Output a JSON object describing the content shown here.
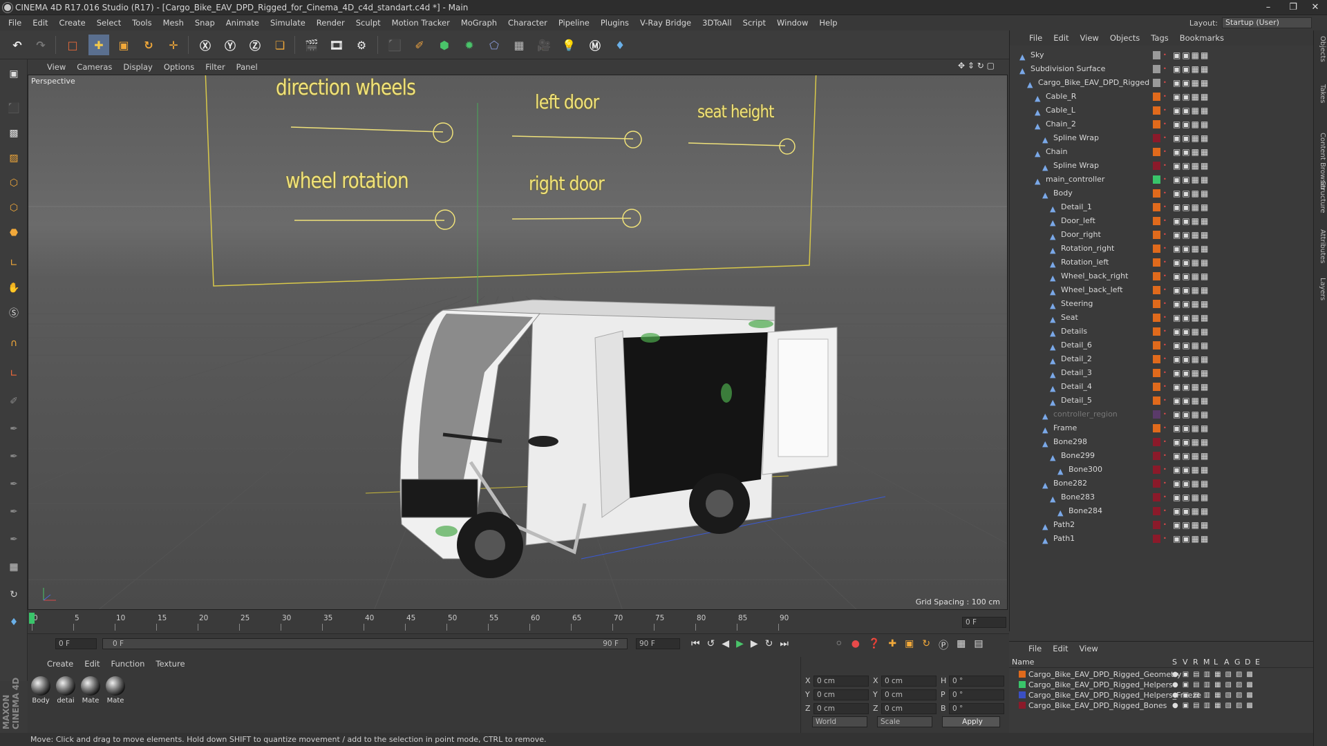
{
  "title": "CINEMA 4D R17.016 Studio (R17) - [Cargo_Bike_EAV_DPD_Rigged_for_Cinema_4D_c4d_standart.c4d *] - Main",
  "menu": [
    "File",
    "Edit",
    "Create",
    "Select",
    "Tools",
    "Mesh",
    "Snap",
    "Animate",
    "Simulate",
    "Render",
    "Sculpt",
    "Motion Tracker",
    "MoGraph",
    "Character",
    "Pipeline",
    "Plugins",
    "V-Ray Bridge",
    "3DToAll",
    "Script",
    "Window",
    "Help"
  ],
  "layout": {
    "label": "Layout:",
    "value": "Startup (User)"
  },
  "viewport": {
    "menu": [
      "View",
      "Cameras",
      "Display",
      "Options",
      "Filter",
      "Panel"
    ],
    "label": "Perspective",
    "grid_spacing": "Grid Spacing : 100 cm",
    "controls": [
      "direction wheels",
      "left door",
      "seat height",
      "wheel rotation",
      "right door"
    ]
  },
  "timeline": {
    "ticks": [
      "0",
      "5",
      "10",
      "15",
      "20",
      "25",
      "30",
      "35",
      "40",
      "45",
      "50",
      "55",
      "60",
      "65",
      "70",
      "75",
      "80",
      "85",
      "90"
    ],
    "current": "0 F"
  },
  "transport": {
    "start": "0 F",
    "range_start": "0 F",
    "range_end": "90 F",
    "end": "90 F"
  },
  "materials": {
    "menu": [
      "Create",
      "Edit",
      "Function",
      "Texture"
    ],
    "items": [
      "Body",
      "detai",
      "Mate",
      "Mate"
    ]
  },
  "coords": {
    "rows": [
      {
        "a": "X",
        "av": "0 cm",
        "b": "X",
        "bv": "0 cm",
        "c": "H",
        "cv": "0 °"
      },
      {
        "a": "Y",
        "av": "0 cm",
        "b": "Y",
        "bv": "0 cm",
        "c": "P",
        "cv": "0 °"
      },
      {
        "a": "Z",
        "av": "0 cm",
        "b": "Z",
        "bv": "0 cm",
        "c": "B",
        "cv": "0 °"
      }
    ],
    "mode": "World",
    "scale": "Scale",
    "apply": "Apply",
    "top1": "--",
    "top2": "--"
  },
  "status": "Move: Click and drag to move elements. Hold down SHIFT to quantize movement / add to the selection in point mode, CTRL to remove.",
  "object_manager": {
    "menu": [
      "File",
      "Edit",
      "View",
      "Objects",
      "Tags",
      "Bookmarks"
    ],
    "objects": [
      {
        "name": "Sky",
        "depth": 0,
        "color": "#9a9a9a"
      },
      {
        "name": "Subdivision Surface",
        "depth": 0,
        "color": "#9a9a9a"
      },
      {
        "name": "Cargo_Bike_EAV_DPD_Rigged",
        "depth": 1,
        "color": "#9a9a9a"
      },
      {
        "name": "Cable_R",
        "depth": 2,
        "color": "#e06a1c"
      },
      {
        "name": "Cable_L",
        "depth": 2,
        "color": "#e06a1c"
      },
      {
        "name": "Chain_2",
        "depth": 2,
        "color": "#e06a1c"
      },
      {
        "name": "Spline Wrap",
        "depth": 3,
        "color": "#8b1a2a"
      },
      {
        "name": "Chain",
        "depth": 2,
        "color": "#e06a1c"
      },
      {
        "name": "Spline Wrap",
        "depth": 3,
        "color": "#8b1a2a"
      },
      {
        "name": "main_controller",
        "depth": 2,
        "color": "#39c46a"
      },
      {
        "name": "Body",
        "depth": 3,
        "color": "#e06a1c"
      },
      {
        "name": "Detail_1",
        "depth": 4,
        "color": "#e06a1c"
      },
      {
        "name": "Door_left",
        "depth": 4,
        "color": "#e06a1c"
      },
      {
        "name": "Door_right",
        "depth": 4,
        "color": "#e06a1c"
      },
      {
        "name": "Rotation_right",
        "depth": 4,
        "color": "#e06a1c"
      },
      {
        "name": "Rotation_left",
        "depth": 4,
        "color": "#e06a1c"
      },
      {
        "name": "Wheel_back_right",
        "depth": 4,
        "color": "#e06a1c"
      },
      {
        "name": "Wheel_back_left",
        "depth": 4,
        "color": "#e06a1c"
      },
      {
        "name": "Steering",
        "depth": 4,
        "color": "#e06a1c"
      },
      {
        "name": "Seat",
        "depth": 4,
        "color": "#e06a1c"
      },
      {
        "name": "Details",
        "depth": 4,
        "color": "#e06a1c"
      },
      {
        "name": "Detail_6",
        "depth": 4,
        "color": "#e06a1c"
      },
      {
        "name": "Detail_2",
        "depth": 4,
        "color": "#e06a1c"
      },
      {
        "name": "Detail_3",
        "depth": 4,
        "color": "#e06a1c"
      },
      {
        "name": "Detail_4",
        "depth": 4,
        "color": "#e06a1c"
      },
      {
        "name": "Detail_5",
        "depth": 4,
        "color": "#e06a1c"
      },
      {
        "name": "controller_region",
        "depth": 3,
        "color": "#5a3a6a"
      },
      {
        "name": "Frame",
        "depth": 3,
        "color": "#e06a1c"
      },
      {
        "name": "Bone298",
        "depth": 3,
        "color": "#8b1a2a"
      },
      {
        "name": "Bone299",
        "depth": 4,
        "color": "#8b1a2a"
      },
      {
        "name": "Bone300",
        "depth": 5,
        "color": "#8b1a2a"
      },
      {
        "name": "Bone282",
        "depth": 3,
        "color": "#8b1a2a"
      },
      {
        "name": "Bone283",
        "depth": 4,
        "color": "#8b1a2a"
      },
      {
        "name": "Bone284",
        "depth": 5,
        "color": "#8b1a2a"
      },
      {
        "name": "Path2",
        "depth": 3,
        "color": "#8b1a2a"
      },
      {
        "name": "Path1",
        "depth": 3,
        "color": "#8b1a2a"
      }
    ]
  },
  "layer_manager": {
    "menu": [
      "File",
      "Edit",
      "View"
    ],
    "header": {
      "name": "Name",
      "cols": [
        "S",
        "V",
        "R",
        "M",
        "L",
        "A",
        "G",
        "D",
        "E"
      ]
    },
    "layers": [
      {
        "name": "Cargo_Bike_EAV_DPD_Rigged_Geometry",
        "color": "#e06a1c"
      },
      {
        "name": "Cargo_Bike_EAV_DPD_Rigged_Helpers",
        "color": "#39c46a"
      },
      {
        "name": "Cargo_Bike_EAV_DPD_Rigged_Helpers_Freeze",
        "color": "#3a4fc4"
      },
      {
        "name": "Cargo_Bike_EAV_DPD_Rigged_Bones",
        "color": "#8b1a2a"
      }
    ]
  },
  "side_tabs": [
    "Objects",
    "Takes",
    "Content Browser",
    "Structure",
    "Attributes",
    "Layers"
  ],
  "brand": "MAXON CINEMA 4D"
}
